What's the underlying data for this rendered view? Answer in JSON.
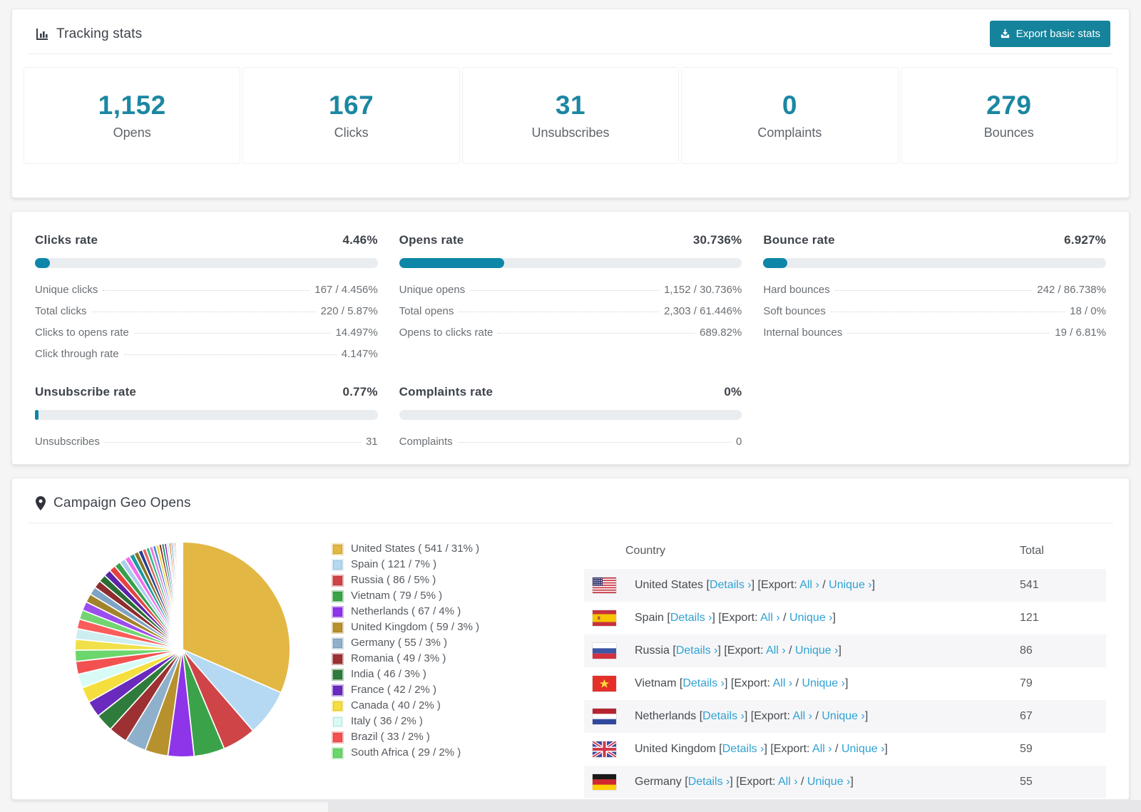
{
  "page": {
    "bg_color": "#f5f5f6",
    "accent_color": "#1b87a2",
    "bar_fill_color": "#0e86a8",
    "button_color": "#15839b",
    "link_color": "#2fa2d3"
  },
  "tracking": {
    "title": "Tracking stats",
    "export_button_label": "Export basic stats",
    "stats": [
      {
        "value": "1,152",
        "label": "Opens"
      },
      {
        "value": "167",
        "label": "Clicks"
      },
      {
        "value": "31",
        "label": "Unsubscribes"
      },
      {
        "value": "0",
        "label": "Complaints"
      },
      {
        "value": "279",
        "label": "Bounces"
      }
    ]
  },
  "rates": {
    "sections": [
      {
        "id": "clicks-rate",
        "title": "Clicks rate",
        "value": "4.46%",
        "percent": 4.46,
        "rows": [
          [
            "Unique clicks",
            "167 / 4.456%"
          ],
          [
            "Total clicks",
            "220 / 5.87%"
          ],
          [
            "Clicks to opens rate",
            "14.497%"
          ],
          [
            "Click through rate",
            "4.147%"
          ]
        ]
      },
      {
        "id": "opens-rate",
        "title": "Opens rate",
        "value": "30.736%",
        "percent": 30.736,
        "rows": [
          [
            "Unique opens",
            "1,152 / 30.736%"
          ],
          [
            "Total opens",
            "2,303 / 61.446%"
          ],
          [
            "Opens to clicks rate",
            "689.82%"
          ]
        ]
      },
      {
        "id": "bounce-rate",
        "title": "Bounce rate",
        "value": "6.927%",
        "percent": 6.927,
        "rows": [
          [
            "Hard bounces",
            "242 / 86.738%"
          ],
          [
            "Soft bounces",
            "18 / 0%"
          ],
          [
            "Internal bounces",
            "19 / 6.81%"
          ]
        ]
      },
      {
        "id": "unsubscribe-rate",
        "title": "Unsubscribe rate",
        "value": "0.77%",
        "percent": 0.77,
        "rows": [
          [
            "Unsubscribes",
            "31"
          ]
        ]
      },
      {
        "id": "complaints-rate",
        "title": "Complaints rate",
        "value": "0%",
        "percent": 0,
        "rows": [
          [
            "Complaints",
            "0"
          ]
        ]
      }
    ]
  },
  "geo": {
    "title": "Campaign Geo Opens",
    "table": {
      "headers": [
        "Country",
        "Total"
      ],
      "details_label": "Details",
      "export_label": "Export:",
      "all_label": "All",
      "unique_label": "Unique",
      "chevron": "›",
      "rows": [
        {
          "flag": "us",
          "country": "United States",
          "total": "541"
        },
        {
          "flag": "es",
          "country": "Spain",
          "total": "121"
        },
        {
          "flag": "ru",
          "country": "Russia",
          "total": "86"
        },
        {
          "flag": "vn",
          "country": "Vietnam",
          "total": "79"
        },
        {
          "flag": "nl",
          "country": "Netherlands",
          "total": "67"
        },
        {
          "flag": "gb",
          "country": "United Kingdom",
          "total": "59"
        },
        {
          "flag": "de",
          "country": "Germany",
          "total": "55"
        }
      ]
    }
  },
  "chart_data": {
    "type": "pie",
    "title": "Campaign Geo Opens",
    "legend_position": "right",
    "series": [
      {
        "label": "United States",
        "value": 541,
        "pct": 31,
        "color": "#e3b744"
      },
      {
        "label": "Spain",
        "value": 121,
        "pct": 7,
        "color": "#b5d9f2"
      },
      {
        "label": "Russia",
        "value": 86,
        "pct": 5,
        "color": "#cf4447"
      },
      {
        "label": "Vietnam",
        "value": 79,
        "pct": 5,
        "color": "#3aa349"
      },
      {
        "label": "Netherlands",
        "value": 67,
        "pct": 4,
        "color": "#8e34e9"
      },
      {
        "label": "United Kingdom",
        "value": 59,
        "pct": 3,
        "color": "#b7912d"
      },
      {
        "label": "Germany",
        "value": 55,
        "pct": 3,
        "color": "#8fb0cb"
      },
      {
        "label": "Romania",
        "value": 49,
        "pct": 3,
        "color": "#9c3033"
      },
      {
        "label": "India",
        "value": 46,
        "pct": 3,
        "color": "#2f7b3b"
      },
      {
        "label": "France",
        "value": 42,
        "pct": 2,
        "color": "#6a2abd"
      },
      {
        "label": "Canada",
        "value": 40,
        "pct": 2,
        "color": "#f5df3e"
      },
      {
        "label": "Italy",
        "value": 36,
        "pct": 2,
        "color": "#d9fbf5"
      },
      {
        "label": "Brazil",
        "value": 33,
        "pct": 2,
        "color": "#f25150"
      },
      {
        "label": "South Africa",
        "value": 29,
        "pct": 2,
        "color": "#6bd66b"
      }
    ],
    "other_slices": {
      "values": [
        28,
        27,
        25,
        24,
        23,
        22,
        21,
        20,
        19,
        18,
        17,
        16,
        15,
        14,
        13,
        12,
        11,
        10,
        9,
        9,
        8,
        8,
        7,
        7,
        6,
        6,
        5,
        5,
        4,
        4,
        3,
        3,
        3,
        2,
        2,
        2,
        1,
        1
      ],
      "colors": [
        "#f0e14a",
        "#cdeef0",
        "#fa5d5b",
        "#72d572",
        "#9b4dee",
        "#a3832a",
        "#7fa3c4",
        "#8e2c2e",
        "#2a6e35",
        "#5d23a8",
        "#e6413f",
        "#35a04a",
        "#aacfec",
        "#f06eee",
        "#1a9ba0",
        "#877428",
        "#24408e",
        "#e06a68",
        "#2bbd84",
        "#e87ee0",
        "#4485d8",
        "#f2d43c",
        "#93291d",
        "#0a9878",
        "#9a15b0",
        "#c2ecf5",
        "#d35705",
        "#5c96c0",
        "#90a5b8",
        "#f64b49",
        "#8b16fa",
        "#35707e",
        "#a0dccd",
        "#f96b10",
        "#8f3e86",
        "#4eccc4",
        "#d2537e",
        "#dcc6e0"
      ]
    }
  }
}
